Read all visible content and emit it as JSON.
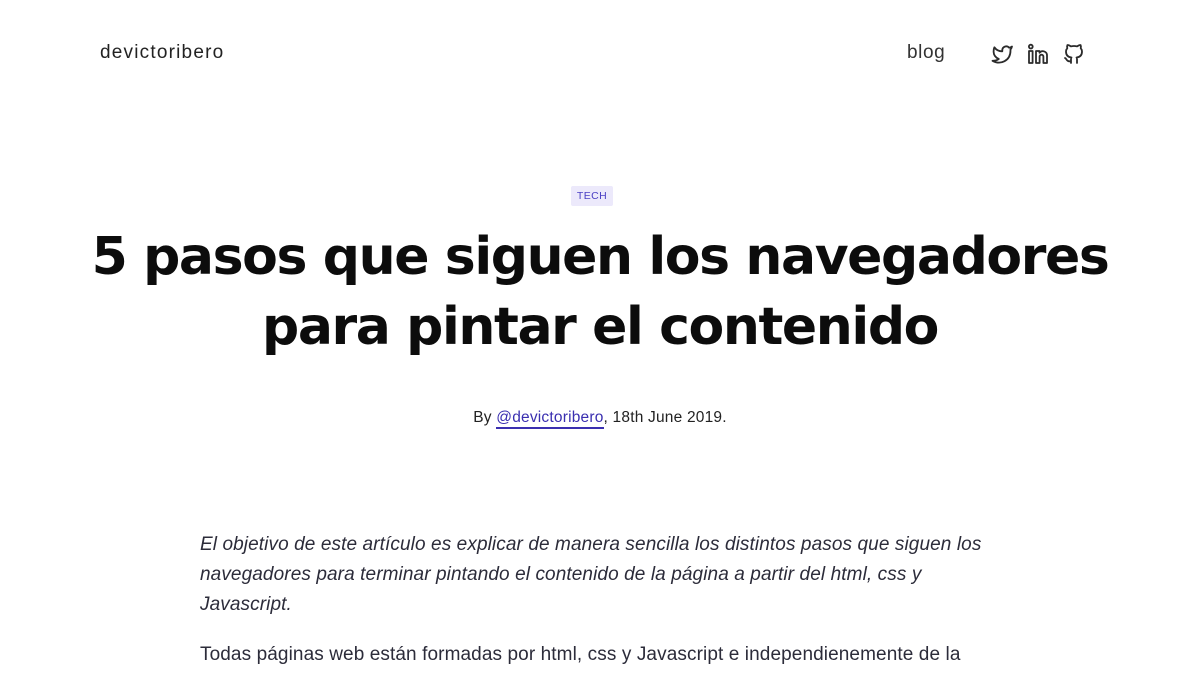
{
  "header": {
    "brand": "devictoribero",
    "nav_blog": "blog",
    "social": [
      {
        "name": "twitter-icon"
      },
      {
        "name": "linkedin-icon"
      },
      {
        "name": "github-icon"
      }
    ],
    "icon_color": "#2b2b2b"
  },
  "article": {
    "tag": "TECH",
    "title_line1": "5 pasos que siguen los navegadores",
    "title_line2": "para pintar el contenido",
    "byline_prefix": "By",
    "author": "@devictoribero",
    "byline_suffix": ", 18th June 2019.",
    "intro": "El objetivo de este artículo es explicar de manera sencilla los distintos pasos que siguen los navegadores para terminar pintando el contenido de la página a partir del html, css y Javascript.",
    "paragraph_start": "Todas páginas web están formadas por html, css y Javascript e independienemente de la"
  },
  "colors": {
    "accent": "#3a2fb0",
    "tag_bg": "#ece9fb",
    "text": "#2c2c3a"
  }
}
